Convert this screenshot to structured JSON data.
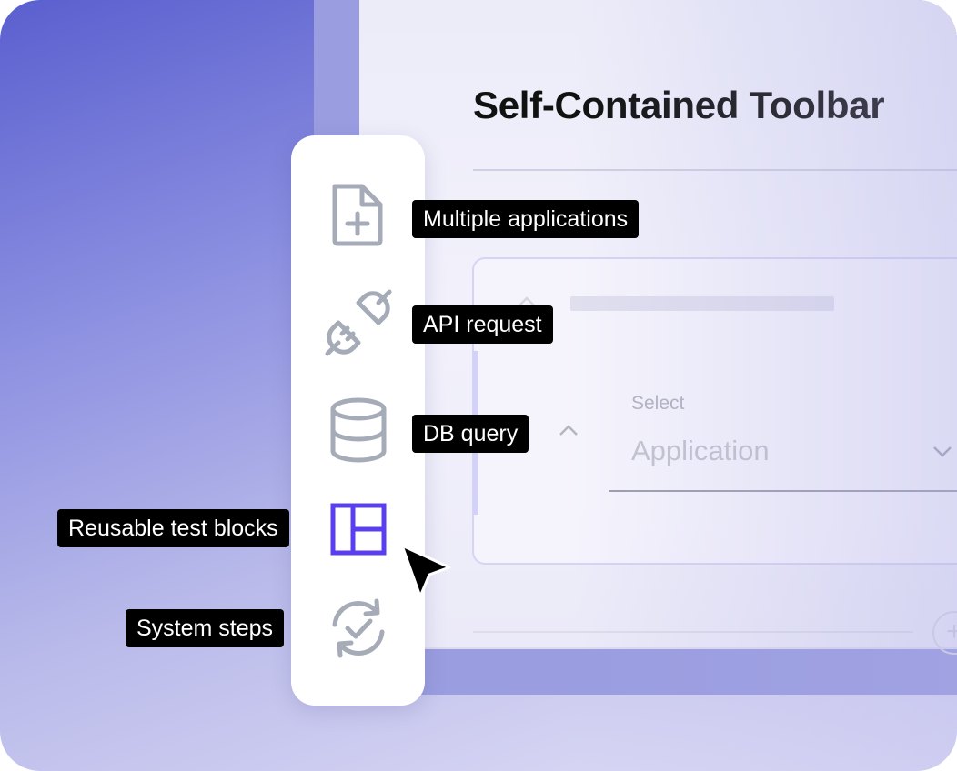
{
  "page": {
    "title": "Self-Contained Toolbar"
  },
  "form": {
    "select_label": "Select",
    "select_value": "Application"
  },
  "toolbar": {
    "items": [
      {
        "icon": "file-plus-icon",
        "tooltip": "Multiple applications",
        "active": false
      },
      {
        "icon": "plug-icon",
        "tooltip": "API request",
        "active": false
      },
      {
        "icon": "database-icon",
        "tooltip": "DB query",
        "active": false
      },
      {
        "icon": "layout-icon",
        "tooltip": "Reusable test blocks",
        "active": true
      },
      {
        "icon": "refresh-check-icon",
        "tooltip": "System steps",
        "active": false
      }
    ]
  },
  "colors": {
    "icon_gray": "#a6abb8",
    "icon_active": "#5a3ff0",
    "tooltip_bg": "#000000",
    "tooltip_text": "#ffffff"
  }
}
